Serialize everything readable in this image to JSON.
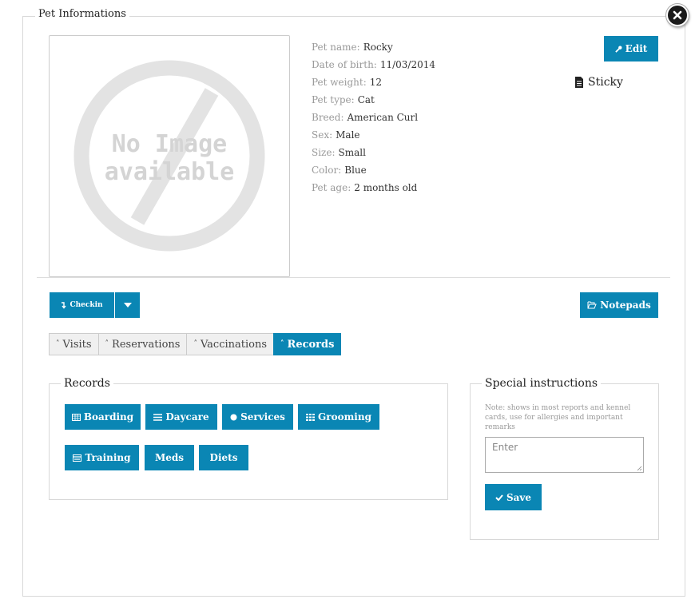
{
  "modal": {
    "title": "Pet Informations"
  },
  "pet": {
    "fields": [
      {
        "label": "Pet name:",
        "value": "Rocky"
      },
      {
        "label": "Date of birth:",
        "value": "11/03/2014"
      },
      {
        "label": "Pet weight:",
        "value": "12"
      },
      {
        "label": "Pet type:",
        "value": "Cat"
      },
      {
        "label": "Breed:",
        "value": "American Curl"
      },
      {
        "label": "Sex:",
        "value": "Male"
      },
      {
        "label": "Size:",
        "value": "Small"
      },
      {
        "label": "Color:",
        "value": "Blue"
      },
      {
        "label": "Pet age:",
        "value": "2 months old"
      }
    ],
    "photo_text": [
      "No Image",
      "available"
    ]
  },
  "actions": {
    "edit": "Edit",
    "sticky": "Sticky",
    "checkin": "Checkin",
    "notepads": "Notepads"
  },
  "tabs": [
    {
      "label": "Visits"
    },
    {
      "label": "Reservations"
    },
    {
      "label": "Vaccinations"
    },
    {
      "label": "Records",
      "active": true
    }
  ],
  "records": {
    "title": "Records",
    "buttons": [
      {
        "label": "Boarding",
        "icon": "table-icon"
      },
      {
        "label": "Daycare",
        "icon": "list-icon"
      },
      {
        "label": "Services",
        "icon": "circle-icon"
      },
      {
        "label": "Grooming",
        "icon": "grid-icon"
      },
      {
        "label": "Training",
        "icon": "card-icon"
      },
      {
        "label": "Meds",
        "icon": ""
      },
      {
        "label": "Diets",
        "icon": ""
      }
    ]
  },
  "special": {
    "title": "Special instructions",
    "note": "Note: shows in most reports and kennel cards, use for allergies and important remarks",
    "placeholder": "Enter",
    "save": "Save"
  },
  "colors": {
    "primary": "#0a86b4",
    "border": "#d8d8d8"
  }
}
